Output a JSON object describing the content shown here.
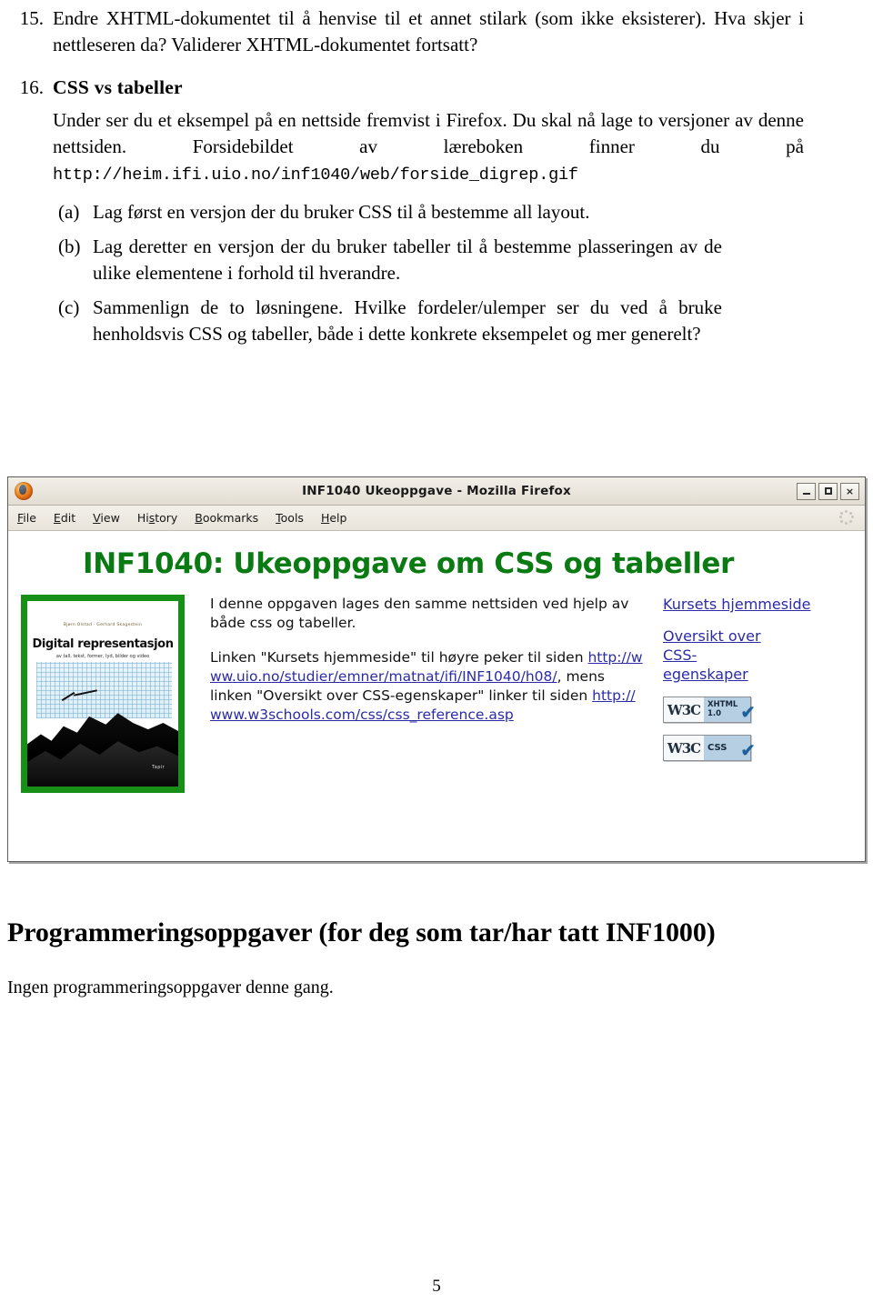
{
  "document": {
    "items": [
      {
        "number": "15.",
        "text": "Endre XHTML-dokumentet til å henvise til et annet stilark (som ikke eksisterer). Hva skjer i nettleseren da? Validerer XHTML-dokumentet fortsatt?"
      },
      {
        "number": "16.",
        "heading": "CSS vs tabeller",
        "para_before_url": "Under ser du et eksempel på en nettside fremvist i Firefox. Du skal nå lage to versjoner av denne nettsiden. Forsidebildet av læreboken finner du på ",
        "url": "http://heim.ifi.uio.no/inf1040/web/forside_digrep.gif",
        "subitems": [
          {
            "label": "(a)",
            "text": "Lag først en versjon der du bruker CSS til å bestemme all layout."
          },
          {
            "label": "(b)",
            "text": "Lag deretter en versjon der du bruker tabeller til å bestemme plasseringen av de ulike elementene i forhold til hverandre."
          },
          {
            "label": "(c)",
            "text": "Sammenlign de to løsningene. Hvilke fordeler/ulemper ser du ved å bruke henholdsvis CSS og tabeller, både i dette konkrete eksempelet og mer generelt?"
          }
        ]
      }
    ],
    "bottom_heading": "Programmeringsoppgaver (for deg som tar/har tatt INF1000)",
    "bottom_text": "Ingen programmeringsoppgaver denne gang.",
    "page_number": "5"
  },
  "firefox": {
    "title": "INF1040 Ukeoppgave - Mozilla Firefox",
    "window_buttons": {
      "minimize": "minimize-button",
      "maximize": "maximize-button",
      "close": "×"
    },
    "menu": [
      {
        "pre": "",
        "accel": "F",
        "post": "ile"
      },
      {
        "pre": "",
        "accel": "E",
        "post": "dit"
      },
      {
        "pre": "",
        "accel": "V",
        "post": "iew"
      },
      {
        "pre": "Hi",
        "accel": "s",
        "post": "tory"
      },
      {
        "pre": "",
        "accel": "B",
        "post": "ookmarks"
      },
      {
        "pre": "",
        "accel": "T",
        "post": "ools"
      },
      {
        "pre": "",
        "accel": "H",
        "post": "elp"
      }
    ],
    "page": {
      "heading": "INF1040: Ukeoppgave om CSS og tabeller",
      "heading_color": "#0a7a12",
      "link_color": "#2b2ba8",
      "book_cover": {
        "authors": "Bjørn Olstad · Gerhard Skagestein",
        "title": "Digital representasjon",
        "subtitle": "av tall, tekst, former, lyd, bilder og video",
        "publisher": "Tapir"
      },
      "paragraph_1": "I denne oppgaven lages den samme nettsiden ved hjelp av både css og tabeller.",
      "paragraph_2_part1": "Linken \"Kursets hjemmeside\" til høyre peker til siden ",
      "paragraph_2_link1": "http://www.uio.no/studier/emner/matnat/ifi/INF1040/h08/",
      "paragraph_2_part2": ", mens linken \"Oversikt over CSS-egenskaper\" linker til siden ",
      "paragraph_2_link2": "http://www.w3schools.com/css/css_reference.asp",
      "links": [
        {
          "label": "Kursets hjemmeside"
        },
        {
          "label": "Oversikt over CSS-egenskaper"
        }
      ],
      "badges": [
        {
          "w3c": "W3C",
          "label_line1": "XHTML",
          "label_line2": "1.0",
          "check": "✔"
        },
        {
          "w3c": "W3C",
          "label_line1": "CSS",
          "label_line2": "",
          "check": "✔"
        }
      ]
    }
  }
}
